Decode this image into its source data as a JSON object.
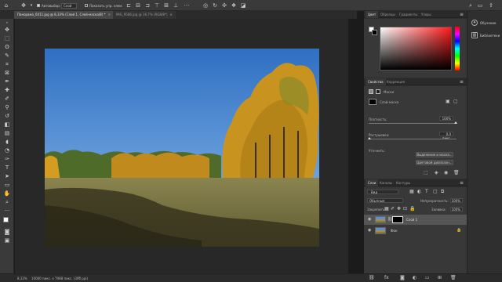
{
  "options_bar": {
    "auto_select_label": "Автовыбор:",
    "auto_select_value": "Слой",
    "show_controls_label": "Показать упр. элем."
  },
  "tabs": [
    {
      "label": "Панорама_6411.jpg @ 8,33% (Слой 1, Слой-маска/8) *",
      "close": "×"
    },
    {
      "label": "IMG_9586.jpg @ 16,7% (RGB/8*)",
      "close": "×"
    }
  ],
  "status": {
    "zoom": "8,33%",
    "doc_size": "10000 пикс. x 7988 пикс. (300 ppi)"
  },
  "color_panel": {
    "tabs": [
      "Цвет",
      "Образцы",
      "Градиенты",
      "Узоры"
    ],
    "fg": "#ffffff",
    "bg": "#000000"
  },
  "properties_panel": {
    "tabs": [
      "Свойства",
      "Коррекция"
    ],
    "section": "Маски",
    "mask_label": "Слой-маска",
    "density_label": "Плотность:",
    "density_value": "100%",
    "feather_label": "Растушевка:",
    "feather_value": "0,0 пикс.",
    "refine_label": "Уточнить:",
    "select_mask_btn": "Выделение и маска...",
    "color_range_btn": "Цветовой диапазон..."
  },
  "layers_panel": {
    "tabs": [
      "Слои",
      "Каналы",
      "Контуры"
    ],
    "kind_label": "Вид",
    "blend_mode": "Обычные",
    "opacity_label": "Непрозрачность:",
    "opacity_value": "100%",
    "lock_label": "Закрепить:",
    "fill_label": "Заливка:",
    "fill_value": "100%",
    "layers": [
      {
        "name": "Слой 1"
      },
      {
        "name": "Фон"
      }
    ]
  },
  "dock": {
    "learn": "Обучение",
    "libraries": "Библиотеки"
  },
  "colors": {
    "ui_dark": "#2b2b2b",
    "ui_mid": "#383838",
    "sky": "#3f7fc9",
    "foliage": "#c9931f",
    "grass": "#6d6a3a"
  }
}
